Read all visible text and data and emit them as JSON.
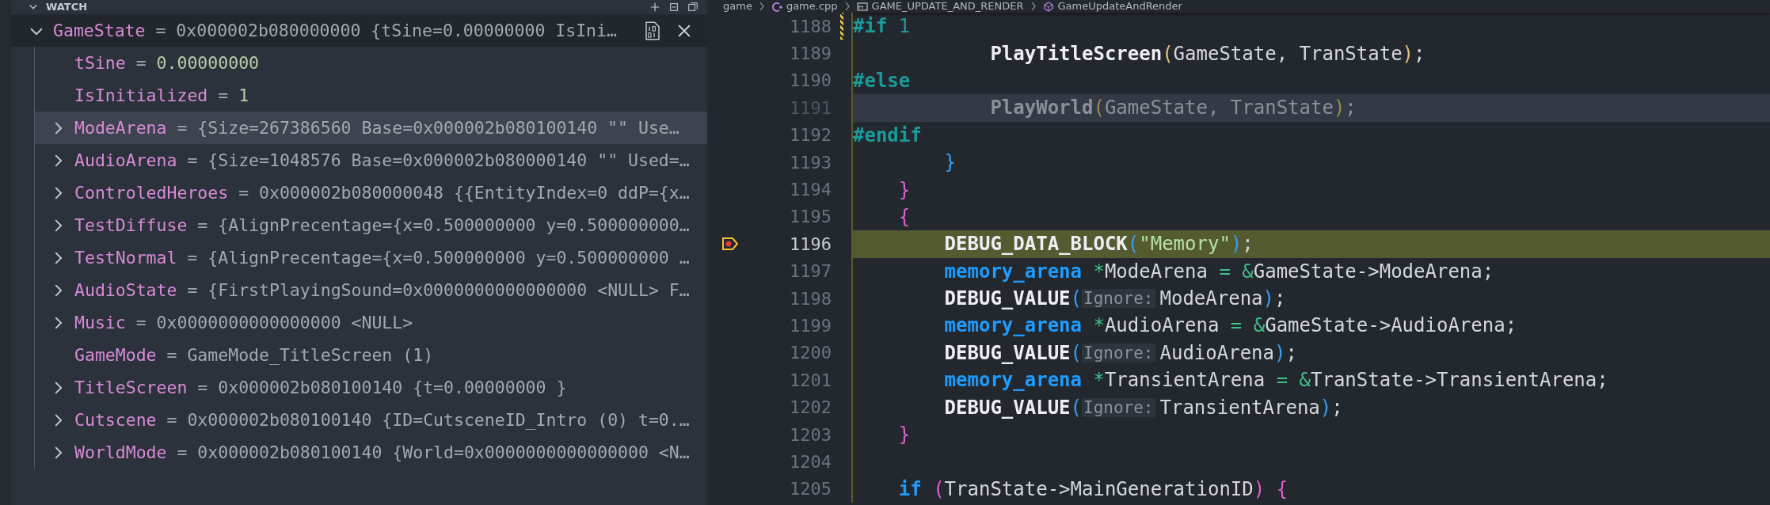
{
  "watch": {
    "title": "WATCH",
    "items": [
      {
        "name": "GameState",
        "operator": "=",
        "value": "0x000002b080000000 {tSine=0.00000000 IsIni…",
        "kind": "node",
        "expanded": true,
        "selected": true,
        "hovered": false,
        "children": [
          {
            "name": "tSine",
            "operator": "=",
            "value": "0.00000000",
            "color": "#b5cea8",
            "kind": "leaf",
            "selected": false,
            "hovered": false
          },
          {
            "name": "IsInitialized",
            "operator": "=",
            "value": "1",
            "color": "#b5cea8",
            "kind": "leaf",
            "selected": false,
            "hovered": false
          },
          {
            "name": "ModeArena",
            "operator": "=",
            "value": "{Size=267386560 Base=0x000002b080100140 \"\" Use…",
            "color": "#a3a8af",
            "kind": "node",
            "expanded": false,
            "selected": false,
            "hovered": true
          },
          {
            "name": "AudioArena",
            "operator": "=",
            "value": "{Size=1048576 Base=0x000002b080000140 \"\" Used=…",
            "color": "#a3a8af",
            "kind": "node",
            "expanded": false,
            "selected": false,
            "hovered": false
          },
          {
            "name": "ControledHeroes",
            "operator": "=",
            "value": "0x000002b080000048 {{EntityIndex=0 ddP={x…",
            "color": "#a3a8af",
            "kind": "node",
            "expanded": false,
            "selected": false,
            "hovered": false
          },
          {
            "name": "TestDiffuse",
            "operator": "=",
            "value": "{AlignPrecentage={x=0.500000000 y=0.500000000…",
            "color": "#a3a8af",
            "kind": "node",
            "expanded": false,
            "selected": false,
            "hovered": false
          },
          {
            "name": "TestNormal",
            "operator": "=",
            "value": "{AlignPrecentage={x=0.500000000 y=0.500000000 …",
            "color": "#a3a8af",
            "kind": "node",
            "expanded": false,
            "selected": false,
            "hovered": false
          },
          {
            "name": "AudioState",
            "operator": "=",
            "value": "{FirstPlayingSound=0x0000000000000000 <NULL> F…",
            "color": "#a3a8af",
            "kind": "node",
            "expanded": false,
            "selected": false,
            "hovered": false
          },
          {
            "name": "Music",
            "operator": "=",
            "value": "0x0000000000000000 <NULL>",
            "color": "#a3a8af",
            "kind": "node",
            "expanded": false,
            "selected": false,
            "hovered": false
          },
          {
            "name": "GameMode",
            "operator": "=",
            "value": "GameMode_TitleScreen (1)",
            "color": "#a3a8af",
            "kind": "leaf",
            "selected": false,
            "hovered": false
          },
          {
            "name": "TitleScreen",
            "operator": "=",
            "value": "0x000002b080100140 {t=0.00000000 }",
            "color": "#a3a8af",
            "kind": "node",
            "expanded": false,
            "selected": false,
            "hovered": false
          },
          {
            "name": "Cutscene",
            "operator": "=",
            "value": "0x000002b080100140 {ID=CutsceneID_Intro (0) t=0.…",
            "color": "#a3a8af",
            "kind": "node",
            "expanded": false,
            "selected": false,
            "hovered": false
          },
          {
            "name": "WorldMode",
            "operator": "=",
            "value": "0x000002b080100140 {World=0x0000000000000000 <N…",
            "color": "#a3a8af",
            "kind": "node",
            "expanded": false,
            "selected": false,
            "hovered": false
          }
        ]
      }
    ]
  },
  "breadcrumb": [
    {
      "text": "game",
      "kind": "folder"
    },
    {
      "text": "game.cpp",
      "kind": "file"
    },
    {
      "text": "GAME_UPDATE_AND_RENDER",
      "kind": "macro"
    },
    {
      "text": "GameUpdateAndRender",
      "kind": "function"
    }
  ],
  "editor": {
    "lines": [
      {
        "number": "1188",
        "current": false,
        "modified": true,
        "inactive": false,
        "tokens": [
          {
            "text": "#if",
            "kind": "directive"
          },
          {
            "text": " 1",
            "kind": "number"
          }
        ]
      },
      {
        "number": "1189",
        "current": false,
        "modified": false,
        "inactive": false,
        "tokens": [
          {
            "text": "            PlayTitleScreen",
            "kind": "func"
          },
          {
            "text": "(",
            "kind": "bracket",
            "color": "#e5c07b"
          },
          {
            "text": "GameState, TranState",
            "kind": "ident"
          },
          {
            "text": ")",
            "kind": "bracket",
            "color": "#e5c07b"
          },
          {
            "text": ";",
            "kind": "ident"
          }
        ]
      },
      {
        "number": "1190",
        "current": false,
        "modified": false,
        "inactive": false,
        "tokens": [
          {
            "text": "#else",
            "kind": "directive"
          }
        ]
      },
      {
        "number": "1191",
        "current": false,
        "modified": false,
        "inactive": true,
        "tokens": [
          {
            "text": "            PlayWorld",
            "kind": "func"
          },
          {
            "text": "(",
            "kind": "bracket",
            "color": "#9c8a4e"
          },
          {
            "text": "GameState, TranState",
            "kind": "ident"
          },
          {
            "text": ")",
            "kind": "bracket",
            "color": "#9c8a4e"
          },
          {
            "text": ";",
            "kind": "ident"
          }
        ]
      },
      {
        "number": "1192",
        "current": false,
        "modified": false,
        "inactive": false,
        "tokens": [
          {
            "text": "#endif",
            "kind": "directive"
          }
        ]
      },
      {
        "number": "1193",
        "current": false,
        "modified": false,
        "inactive": false,
        "tokens": [
          {
            "text": "        }",
            "kind": "bracket",
            "color": "#3a9df5"
          }
        ]
      },
      {
        "number": "1194",
        "current": false,
        "modified": false,
        "inactive": false,
        "tokens": [
          {
            "text": "    }",
            "kind": "bracket",
            "color": "#e05fd0"
          }
        ]
      },
      {
        "number": "1195",
        "current": false,
        "modified": false,
        "inactive": false,
        "tokens": [
          {
            "text": "    {",
            "kind": "bracket",
            "color": "#e05fd0"
          }
        ]
      },
      {
        "number": "1196",
        "current": true,
        "modified": false,
        "inactive": false,
        "tokens": [
          {
            "text": "        DEBUG_DATA_BLOCK",
            "kind": "func"
          },
          {
            "text": "(",
            "kind": "bracket",
            "color": "#3a9df5"
          },
          {
            "text": "\"Memory\"",
            "kind": "string"
          },
          {
            "text": ")",
            "kind": "bracket",
            "color": "#3a9df5"
          },
          {
            "text": ";",
            "kind": "ident"
          }
        ]
      },
      {
        "number": "1197",
        "current": false,
        "modified": false,
        "inactive": false,
        "tokens": [
          {
            "text": "        memory_arena",
            "kind": "type"
          },
          {
            "text": " *",
            "kind": "op"
          },
          {
            "text": "ModeArena ",
            "kind": "ident"
          },
          {
            "text": "=",
            "kind": "op"
          },
          {
            "text": " &",
            "kind": "op"
          },
          {
            "text": "GameState->ModeArena;",
            "kind": "ident"
          }
        ]
      },
      {
        "number": "1198",
        "current": false,
        "modified": false,
        "inactive": false,
        "tokens": [
          {
            "text": "        DEBUG_VALUE",
            "kind": "func"
          },
          {
            "text": "(",
            "kind": "bracket",
            "color": "#3a9df5"
          },
          {
            "text": "Ignore:",
            "kind": "hint"
          },
          {
            "text": "ModeArena",
            "kind": "ident"
          },
          {
            "text": ")",
            "kind": "bracket",
            "color": "#3a9df5"
          },
          {
            "text": ";",
            "kind": "ident"
          }
        ]
      },
      {
        "number": "1199",
        "current": false,
        "modified": false,
        "inactive": false,
        "tokens": [
          {
            "text": "        memory_arena",
            "kind": "type"
          },
          {
            "text": " *",
            "kind": "op"
          },
          {
            "text": "AudioArena ",
            "kind": "ident"
          },
          {
            "text": "=",
            "kind": "op"
          },
          {
            "text": " &",
            "kind": "op"
          },
          {
            "text": "GameState->AudioArena;",
            "kind": "ident"
          }
        ]
      },
      {
        "number": "1200",
        "current": false,
        "modified": false,
        "inactive": false,
        "tokens": [
          {
            "text": "        DEBUG_VALUE",
            "kind": "func"
          },
          {
            "text": "(",
            "kind": "bracket",
            "color": "#3a9df5"
          },
          {
            "text": "Ignore:",
            "kind": "hint"
          },
          {
            "text": "AudioArena",
            "kind": "ident"
          },
          {
            "text": ")",
            "kind": "bracket",
            "color": "#3a9df5"
          },
          {
            "text": ";",
            "kind": "ident"
          }
        ]
      },
      {
        "number": "1201",
        "current": false,
        "modified": false,
        "inactive": false,
        "tokens": [
          {
            "text": "        memory_arena",
            "kind": "type"
          },
          {
            "text": " *",
            "kind": "op"
          },
          {
            "text": "TransientArena ",
            "kind": "ident"
          },
          {
            "text": "=",
            "kind": "op"
          },
          {
            "text": " &",
            "kind": "op"
          },
          {
            "text": "TranState->TransientArena;",
            "kind": "ident"
          }
        ]
      },
      {
        "number": "1202",
        "current": false,
        "modified": false,
        "inactive": false,
        "tokens": [
          {
            "text": "        DEBUG_VALUE",
            "kind": "func"
          },
          {
            "text": "(",
            "kind": "bracket",
            "color": "#3a9df5"
          },
          {
            "text": "Ignore:",
            "kind": "hint"
          },
          {
            "text": "TransientArena",
            "kind": "ident"
          },
          {
            "text": ")",
            "kind": "bracket",
            "color": "#3a9df5"
          },
          {
            "text": ";",
            "kind": "ident"
          }
        ]
      },
      {
        "number": "1203",
        "current": false,
        "modified": false,
        "inactive": false,
        "tokens": [
          {
            "text": "    }",
            "kind": "bracket",
            "color": "#e05fd0"
          }
        ]
      },
      {
        "number": "1204",
        "current": false,
        "modified": false,
        "inactive": false
      },
      {
        "number": "1205",
        "current": false,
        "modified": false,
        "inactive": false,
        "tokens": [
          {
            "text": "    if",
            "kind": "keyword"
          },
          {
            "text": " (",
            "kind": "bracket",
            "color": "#e05fd0"
          },
          {
            "text": "TranState->MainGenerationID",
            "kind": "ident"
          },
          {
            "text": ")",
            "kind": "bracket",
            "color": "#e05fd0"
          },
          {
            "text": " {",
            "kind": "bracket",
            "color": "#e05fd0"
          }
        ]
      }
    ]
  }
}
